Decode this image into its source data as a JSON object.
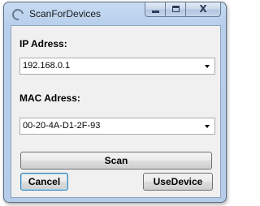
{
  "window": {
    "title": "ScanForDevices",
    "icon": "scan-icon"
  },
  "caption_buttons": {
    "minimize": "minimize-icon",
    "maximize": "maximize-icon",
    "close_glyph": "X"
  },
  "ip": {
    "label": "IP Adress:",
    "value": "192.168.0.1"
  },
  "mac": {
    "label": "MAC Adress:",
    "value": "00-20-4A-D1-2F-93"
  },
  "buttons": {
    "scan": "Scan",
    "cancel": "Cancel",
    "use_device": "UseDevice"
  }
}
